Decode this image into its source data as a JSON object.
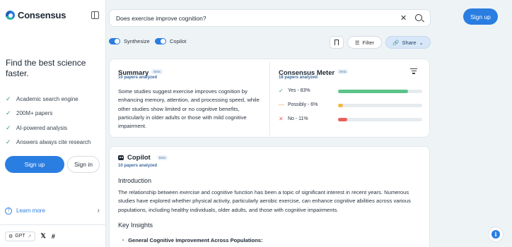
{
  "brand": {
    "name": "Consensus"
  },
  "sidebar": {
    "tagline": "Find the best science faster.",
    "features": [
      "Academic search engine",
      "200M+ papers",
      "AI-powered analysis",
      "Answers always cite research"
    ],
    "signup_label": "Sign up",
    "signin_label": "Sign in",
    "learn_more": "Learn more",
    "gpt_label": "GPT"
  },
  "search": {
    "query": "Does exercise improve cognition?"
  },
  "header": {
    "signup_label": "Sign up"
  },
  "toolbar": {
    "synthesize_label": "Synthesize",
    "copilot_label": "Copilot",
    "filter_label": "Filter",
    "share_label": "Share"
  },
  "summary": {
    "title": "Summary",
    "beta": "Beta",
    "papers": "10 papers analyzed",
    "text": "Some studies suggest exercise improves cognition by enhancing memory, attention, and processing speed, while other studies show limited or no cognitive benefits, particularly in older adults or those with mild cognitive impairment."
  },
  "meter": {
    "title": "Consensus Meter",
    "beta": "Beta",
    "papers": "18 papers analyzed",
    "rows": [
      {
        "label": "Yes - 83%",
        "icon": "✓",
        "percent": 83,
        "color": "#5cc48a",
        "icon_color": "#2a9d8f"
      },
      {
        "label": "Possibly - 6%",
        "icon": "—",
        "percent": 6,
        "color": "#f4b73f",
        "icon_color": "#f0a030"
      },
      {
        "label": "No - 11%",
        "icon": "✕",
        "percent": 11,
        "color": "#e9605a",
        "icon_color": "#e9605a"
      }
    ]
  },
  "copilot": {
    "title": "Copilot",
    "beta": "Beta",
    "papers": "10 papers analyzed",
    "intro_heading": "Introduction",
    "intro_text": "The relationship between exercise and cognitive function has been a topic of significant interest in recent years. Numerous studies have explored whether physical activity, particularly aerobic exercise, can enhance cognitive abilities across various populations, including healthy individuals, older adults, and those with cognitive impairments.",
    "insights_heading": "Key Insights",
    "first_bullet": "General Cognitive Improvement Across Populations:"
  }
}
